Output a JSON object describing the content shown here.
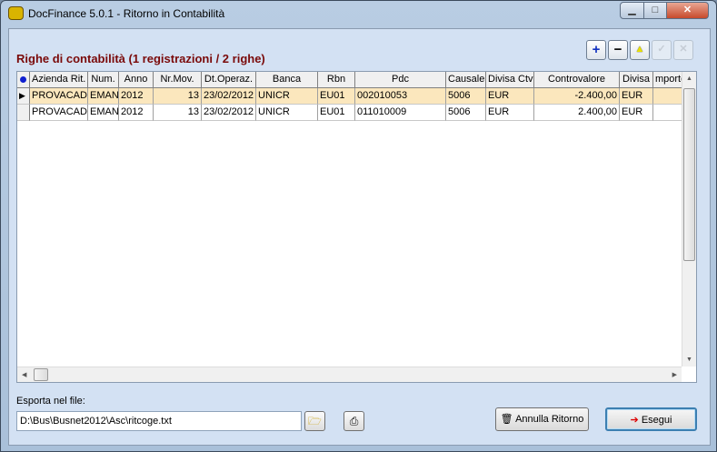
{
  "window": {
    "title": "DocFinance 5.0.1  - Ritorno in Contabilità",
    "minimize": "▁",
    "maximize": "□",
    "close": "✕"
  },
  "heading": "Righe di contabilità  (1 registrazioni / 2 righe)",
  "toolbar": {
    "add": "+",
    "remove": "−",
    "up": "▲",
    "confirm": "✓",
    "cancel": "✕"
  },
  "grid": {
    "columns": [
      "Azienda Rit.",
      "Num.",
      "Anno",
      "Nr.Mov.",
      "Dt.Operaz.",
      "Banca",
      "Rbn",
      "Pdc",
      "Causale",
      "Divisa Ctv",
      "Controvalore",
      "Divisa",
      "mporto"
    ],
    "rows": [
      [
        "PROVACAD(",
        "EMAN",
        "2012",
        "13",
        "23/02/2012",
        "UNICR",
        "EU01",
        "002010053",
        "5006",
        "EUR",
        "-2.400,00",
        "EUR",
        ""
      ],
      [
        "PROVACAD(",
        "EMAN",
        "2012",
        "13",
        "23/02/2012",
        "UNICR",
        "EU01",
        "011010009",
        "5006",
        "EUR",
        "2.400,00",
        "EUR",
        ""
      ]
    ]
  },
  "export": {
    "label": "Esporta nel file:",
    "value": "D:\\Bus\\Busnet2012\\Asc\\ritcoge.txt"
  },
  "buttons": {
    "annulla": "Annulla Ritorno",
    "esegui": "Esegui"
  }
}
